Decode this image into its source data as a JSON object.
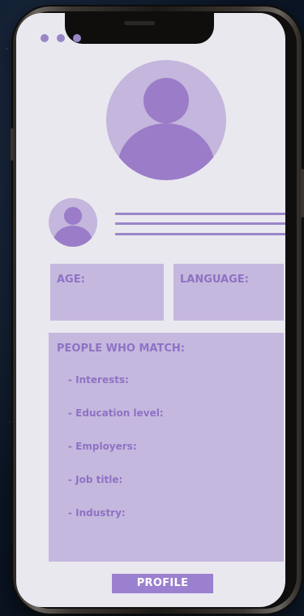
{
  "window_dots": [
    "dot",
    "dot",
    "dot"
  ],
  "colors": {
    "screen_bg": "#e9e8ef",
    "accent": "#9b80cf",
    "panel": "#c5b8de",
    "avatar": "#c4b6dc",
    "silhouette": "#9a7cc9",
    "text": "#8e72c4"
  },
  "profile": {
    "large_avatar_icon": "user-avatar-icon",
    "small_avatar_icon": "user-avatar-icon"
  },
  "fields": {
    "age_label": "AGE:",
    "language_label": "LANGUAGE:"
  },
  "match": {
    "title": "PEOPLE WHO MATCH:",
    "criteria": [
      "- Interests:",
      "- Education level:",
      "- Employers:",
      "- Job title:",
      "- Industry:"
    ]
  },
  "button": {
    "label": "PROFILE"
  }
}
